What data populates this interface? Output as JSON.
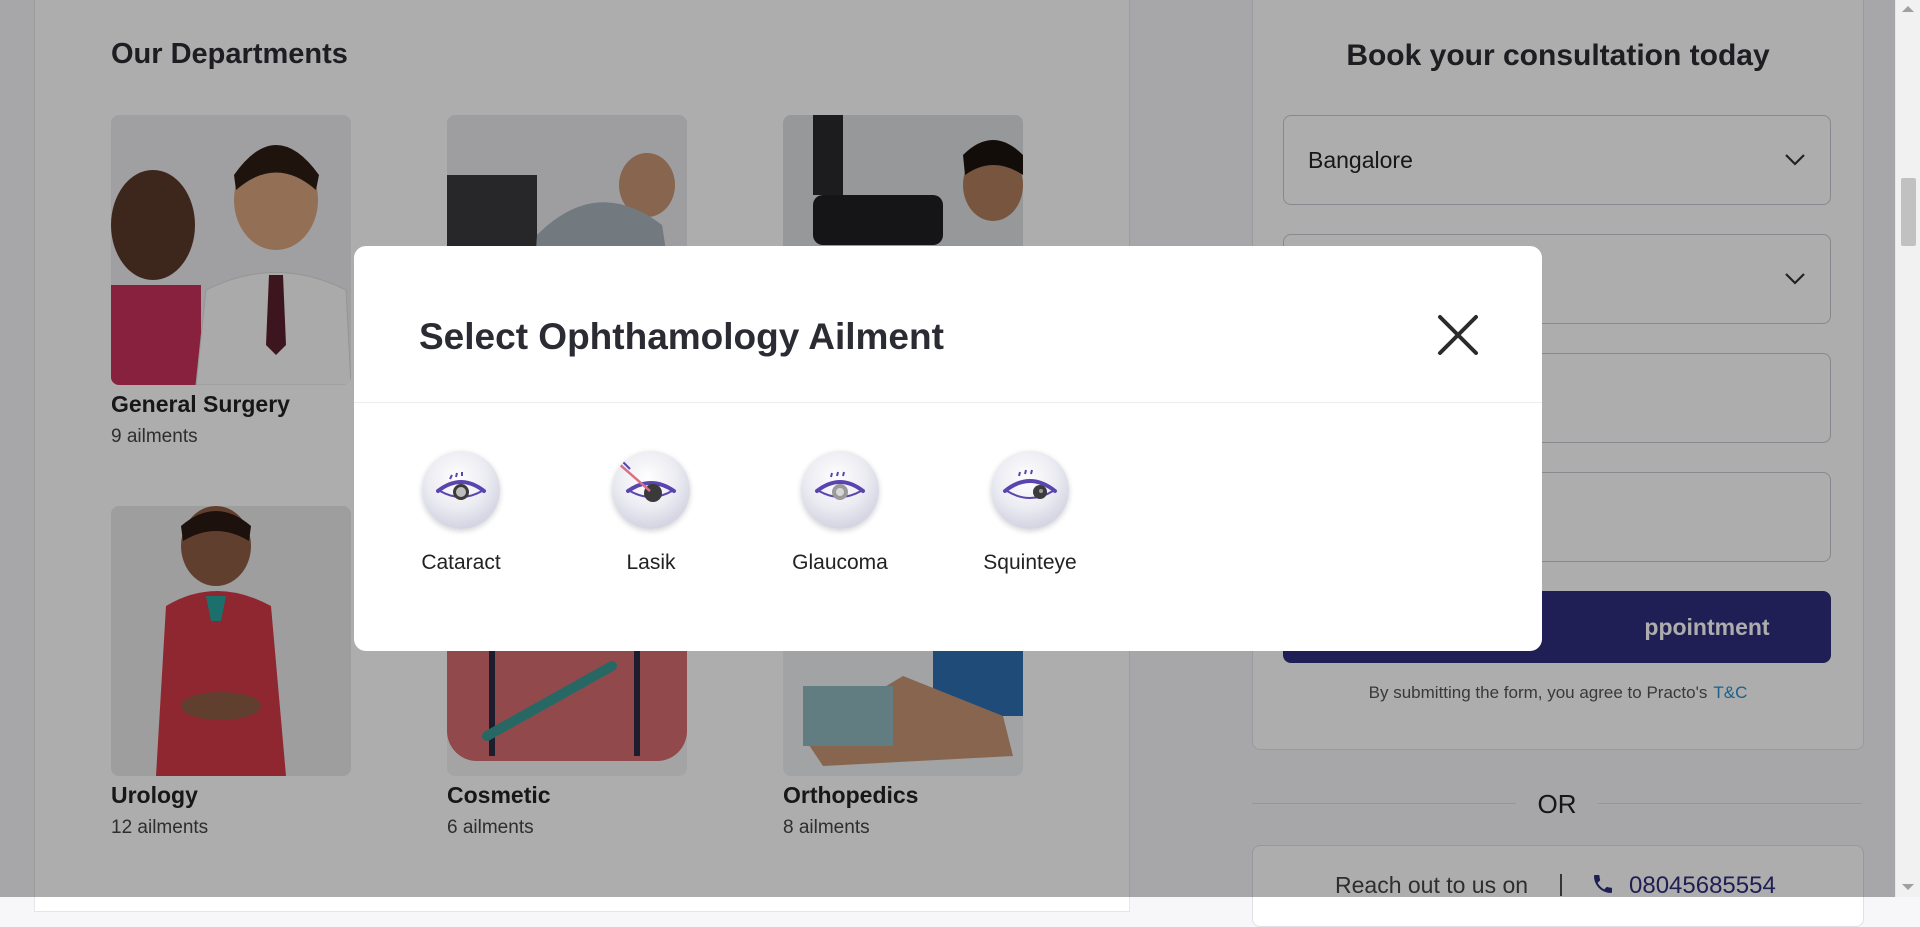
{
  "departments": {
    "heading": "Our Departments",
    "items": [
      {
        "name": "General Surgery",
        "count": "9 ailments"
      },
      {
        "name": "Urology",
        "count": "12 ailments"
      },
      {
        "name": "Cosmetic",
        "count": "6 ailments"
      },
      {
        "name": "Orthopedics",
        "count": "8 ailments"
      }
    ]
  },
  "booking": {
    "title": "Book your consultation today",
    "city_value": "Bangalore",
    "submit_label_visible": "ppointment",
    "terms_text": "By submitting the form, you agree to Practo's",
    "terms_link": "T&C",
    "or_text": "OR",
    "reach_text": "Reach out to us on",
    "reach_separator": "|",
    "phone_number": "08045685554"
  },
  "modal": {
    "title": "Select Ophthamology Ailment",
    "ailments": [
      {
        "label": "Cataract",
        "icon": "cataract-eye-icon"
      },
      {
        "label": "Lasik",
        "icon": "lasik-eye-icon"
      },
      {
        "label": "Glaucoma",
        "icon": "glaucoma-eye-icon"
      },
      {
        "label": "Squinteye",
        "icon": "squint-eye-icon"
      }
    ]
  },
  "colors": {
    "brand_primary": "#2f2f7e",
    "link": "#2a8fc8",
    "eye_purple": "#5a45b0"
  }
}
